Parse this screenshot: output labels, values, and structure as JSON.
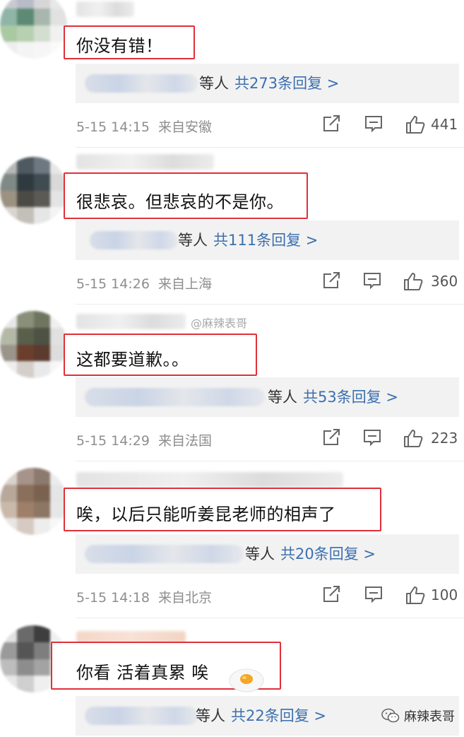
{
  "comments": [
    {
      "text": "你没有错！",
      "reply_etc": "等人",
      "reply_count": "共273条回复 >",
      "time": "5-15 14:15",
      "location": "来自安徽",
      "likes": "441"
    },
    {
      "text": "很悲哀。但悲哀的不是你。",
      "reply_etc": "等人",
      "reply_count": "共111条回复 >",
      "time": "5-15 14:26",
      "location": "来自上海",
      "likes": "360"
    },
    {
      "text": "这都要道歉。。",
      "reply_etc": "等人",
      "reply_count": "共53条回复 >",
      "time": "5-15 14:29",
      "location": "来自法国",
      "likes": "223"
    },
    {
      "text": "唉，以后只能听姜昆老师的相声了",
      "reply_etc": "等人",
      "reply_count": "共20条回复 >",
      "time": "5-15 14:18",
      "location": "来自北京",
      "likes": "100"
    },
    {
      "text": "你看 活着真累 唉",
      "reply_etc": "等人",
      "reply_count": "共22条回复 >"
    }
  ],
  "watermark_mid": "@麻辣表哥",
  "watermark_bottom": "麻辣表哥",
  "icons": [
    "share-icon",
    "comment-icon",
    "like-icon"
  ],
  "colors": {
    "highlight": "#e0303a",
    "link": "#3b6fae",
    "reply_bg": "#f2f2f2"
  }
}
